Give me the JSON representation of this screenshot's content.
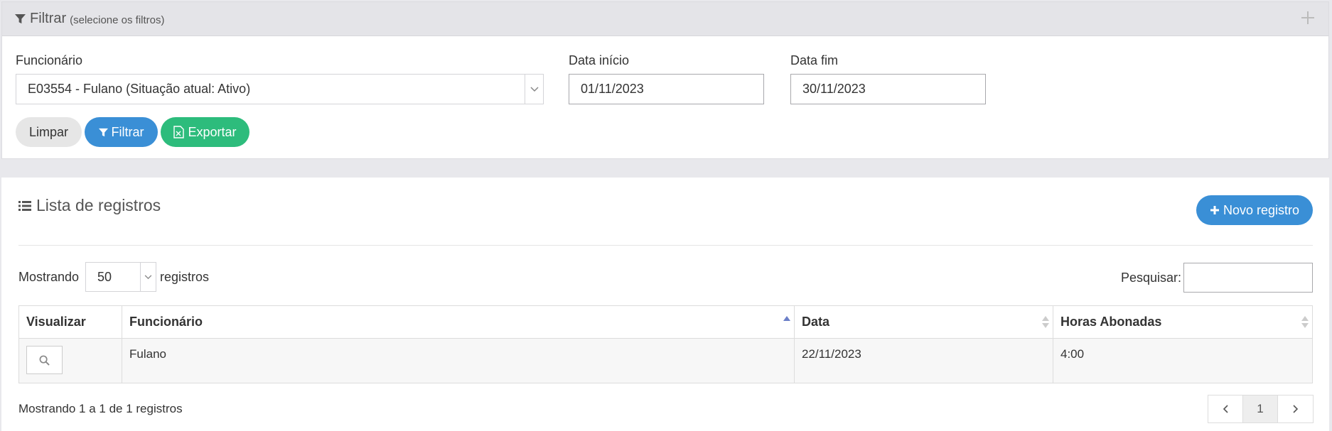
{
  "filter": {
    "title": "Filtrar",
    "subtitle": "(selecione os filtros)",
    "employee_label": "Funcionário",
    "employee_value": "E03554 - Fulano (Situação atual: Ativo)",
    "start_label": "Data início",
    "start_value": "01/11/2023",
    "end_label": "Data fim",
    "end_value": "30/11/2023",
    "clear_label": "Limpar",
    "filter_label": "Filtrar",
    "export_label": "Exportar"
  },
  "list": {
    "title": "Lista de registros",
    "new_label": "Novo registro",
    "show_prefix": "Mostrando",
    "page_length": "50",
    "show_suffix": "registros",
    "search_label": "Pesquisar:",
    "search_value": "",
    "columns": [
      "Visualizar",
      "Funcionário",
      "Data",
      "Horas Abonadas"
    ],
    "rows": [
      {
        "employee": "Fulano",
        "date": "22/11/2023",
        "hours": "4:00"
      }
    ],
    "info": "Mostrando 1 a 1 de 1 registros",
    "pagination": {
      "current": "1"
    }
  },
  "colors": {
    "primary": "#3a8fd6",
    "success": "#2dbc7c",
    "neutral": "#e6e6e6"
  }
}
